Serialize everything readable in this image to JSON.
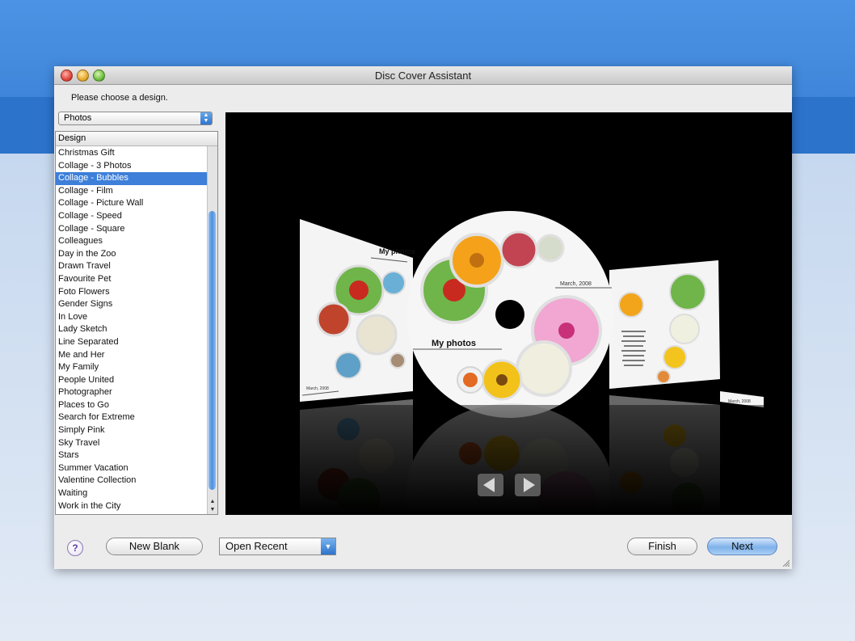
{
  "window": {
    "title": "Disc Cover Assistant"
  },
  "prompt": "Please choose a design.",
  "category": {
    "selected": "Photos"
  },
  "design_list": {
    "header": "Design",
    "selected_index": 2,
    "items": [
      "Christmas Gift",
      "Collage - 3 Photos",
      "Collage - Bubbles",
      "Collage - Film",
      "Collage - Picture Wall",
      "Collage - Speed",
      "Collage - Square",
      "Colleagues",
      "Day in the Zoo",
      "Drawn Travel",
      "Favourite Pet",
      "Foto Flowers",
      "Gender Signs",
      "In Love",
      "Lady Sketch",
      "Line Separated",
      "Me and Her",
      "My Family",
      "People United",
      "Photographer",
      "Places to Go",
      "Search for Extreme",
      "Simply Pink",
      "Sky Travel",
      "Stars",
      "Summer Vacation",
      "Valentine Collection",
      "Waiting",
      "Work in the City"
    ]
  },
  "preview": {
    "disc_title": "My photos",
    "disc_date": "March, 2008",
    "left_title": "My photos",
    "left_date": "March, 2008",
    "spine_date": "March, 2008"
  },
  "buttons": {
    "help": "?",
    "new_blank": "New Blank",
    "open_recent": "Open Recent",
    "finish": "Finish",
    "next": "Next"
  },
  "colors": {
    "selection": "#3d7fd9",
    "desktop_blue": "#4a90e2"
  }
}
